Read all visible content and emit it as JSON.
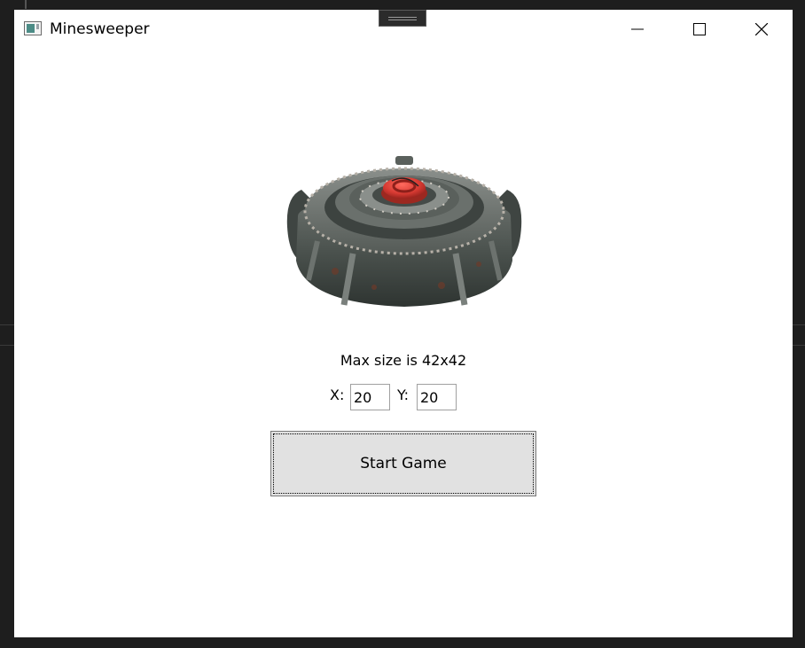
{
  "window": {
    "title": "Minesweeper",
    "icon": "app-window-icon",
    "controls": [
      "minimize-icon",
      "maximize-icon",
      "close-icon"
    ]
  },
  "main": {
    "image": "landmine-image",
    "max_size_text": "Max size is 42x42",
    "x_label": "X:",
    "x_value": "20",
    "y_label": "Y:",
    "y_value": "20",
    "start_label": "Start Game"
  },
  "colors": {
    "window_bg": "#ffffff",
    "button_bg": "#e1e1e1",
    "desktop_bg": "#1e1e1e",
    "mine_cap": "#d63a32",
    "mine_body": "#4a514d"
  }
}
